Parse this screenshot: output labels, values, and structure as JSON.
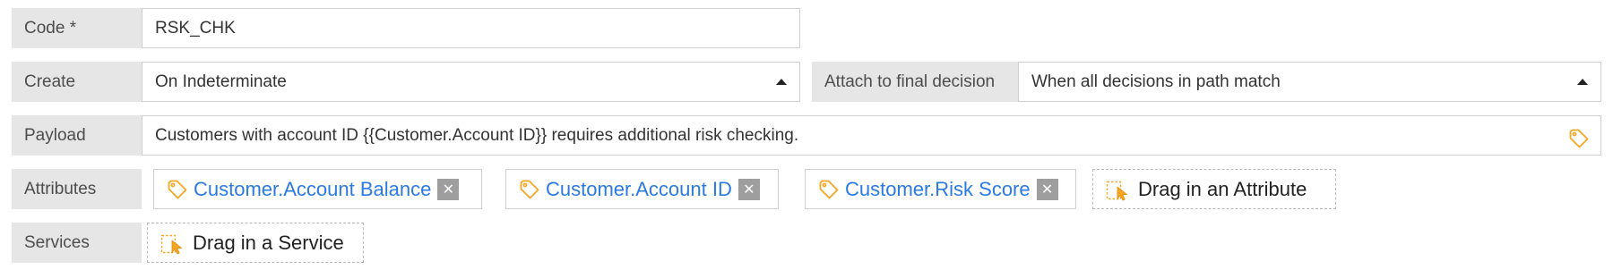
{
  "code": {
    "label": "Code *",
    "value": "RSK_CHK"
  },
  "create": {
    "label": "Create",
    "value": "On Indeterminate"
  },
  "attach": {
    "label": "Attach to final decision",
    "value": "When all decisions in path match"
  },
  "payload": {
    "label": "Payload",
    "value": "Customers with account ID {{Customer.Account ID}} requires additional risk checking.",
    "icon": "tag-icon"
  },
  "attributes": {
    "label": "Attributes",
    "items": [
      {
        "name": "Customer.Account Balance",
        "remove": "✕"
      },
      {
        "name": "Customer.Account ID",
        "remove": "✕"
      },
      {
        "name": "Customer.Risk Score",
        "remove": "✕"
      }
    ],
    "drop_label": "Drag in an Attribute"
  },
  "services": {
    "label": "Services",
    "drop_label": "Drag in a Service"
  },
  "colors": {
    "link": "#2a7ae2",
    "accent": "#f5a623",
    "label_bg": "#e6e6e6",
    "remove_bg": "#9e9e9e"
  }
}
